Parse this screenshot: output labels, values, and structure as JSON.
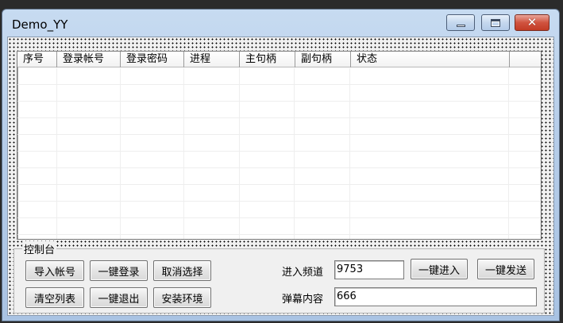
{
  "window": {
    "title": "Demo_YY",
    "controls": {
      "minimize": "minimize",
      "maximize": "maximize",
      "close": "close"
    }
  },
  "listview": {
    "columns": [
      "序号",
      "登录帐号",
      "登录密码",
      "进程",
      "主句柄",
      "副句柄",
      "状态"
    ],
    "rows": []
  },
  "console": {
    "title": "控制台",
    "buttons": {
      "import_accounts": "导入帐号",
      "one_click_login": "一键登录",
      "cancel_selection": "取消选择",
      "clear_list": "清空列表",
      "one_click_logout": "一键退出",
      "install_env": "安装环境",
      "one_click_enter": "一键进入",
      "one_click_send": "一键发送"
    },
    "channel": {
      "label": "进入频道",
      "value": "9753"
    },
    "danmaku": {
      "label": "弹幕内容",
      "value": "666"
    }
  }
}
